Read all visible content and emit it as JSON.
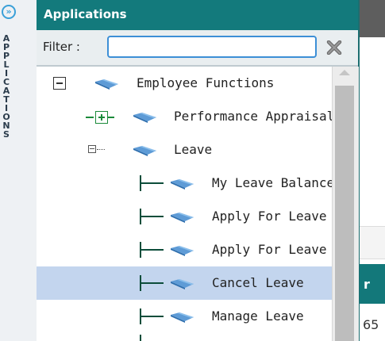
{
  "rail": {
    "letters": [
      "A",
      "P",
      "P",
      "L",
      "I",
      "C",
      "A",
      "T",
      "I",
      "O",
      "N",
      "S"
    ]
  },
  "panel": {
    "title": "Applications",
    "filter": {
      "label": "Filter :",
      "value": "",
      "placeholder": ""
    }
  },
  "tree": {
    "items": [
      {
        "label": "Employee Functions",
        "level": 0,
        "toggle": "minus",
        "selected": false
      },
      {
        "label": "Performance Appraisal",
        "level": 1,
        "toggle": "plus",
        "selected": false
      },
      {
        "label": "Leave",
        "level": 1,
        "toggle": "open",
        "selected": false
      },
      {
        "label": "My Leave Balance",
        "level": 2,
        "toggle": "leaf",
        "selected": false
      },
      {
        "label": "Apply For Leave",
        "level": 2,
        "toggle": "leaf",
        "selected": false
      },
      {
        "label": "Apply For Leave",
        "level": 2,
        "toggle": "leaf",
        "selected": false
      },
      {
        "label": "Cancel Leave",
        "level": 2,
        "toggle": "leaf",
        "selected": true
      },
      {
        "label": "Manage Leave",
        "level": 2,
        "toggle": "leaf",
        "selected": false
      }
    ]
  },
  "background": {
    "teal_text": "r",
    "bottom_number": "65"
  },
  "colors": {
    "header": "#137a7c",
    "selection": "#c3d5ee",
    "input_border": "#3d8fd6"
  }
}
